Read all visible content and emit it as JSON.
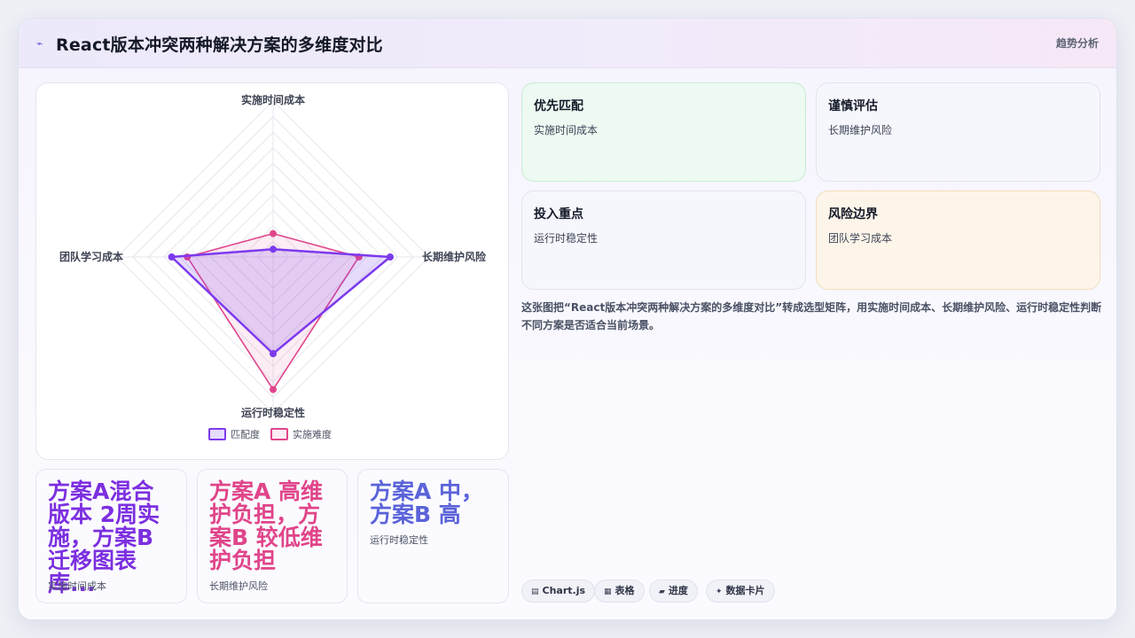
{
  "header": {
    "icon": "trend-icon",
    "title": "React版本冲突两种解决方案的多维度对比",
    "tag": "趋势分析"
  },
  "chart_data": {
    "type": "radar",
    "axes": [
      "实施时间成本",
      "长期维护风险",
      "运行时稳定性",
      "团队学习成本"
    ],
    "rlim": [
      0,
      100
    ],
    "grid": true,
    "legend_position": "bottom",
    "series": [
      {
        "name": "匹配度",
        "values": [
          5,
          75,
          62,
          65
        ],
        "color": "#7c3aed"
      },
      {
        "name": "实施难度",
        "values": [
          15,
          55,
          85,
          55
        ],
        "color": "#e0468c"
      }
    ]
  },
  "stats": [
    {
      "value": "方案A混合版本 2周实施，方案B迁移图表库...",
      "label": "实施时间成本",
      "color": "#7c2fe0"
    },
    {
      "value": "方案A 高维护负担，方案B 较低维护负担",
      "label": "长期维护风险",
      "color": "#e0458a"
    },
    {
      "value": "方案A 中，方案B 高",
      "label": "运行时稳定性",
      "color": "#5b63d9"
    }
  ],
  "insights": [
    {
      "title": "优先匹配",
      "detail": "实施时间成本",
      "bg": "#ecfaf2",
      "border": "#c7ecd7"
    },
    {
      "title": "谨慎评估",
      "detail": "长期维护风险",
      "bg": "#f6f7fc",
      "border": "#e1e4ef"
    },
    {
      "title": "投入重点",
      "detail": "运行时稳定性",
      "bg": "#f6f7fc",
      "border": "#e1e4ef"
    },
    {
      "title": "风险边界",
      "detail": "团队学习成本",
      "bg": "#fdf5e9",
      "border": "#f2dcbd"
    }
  ],
  "summary": "这张图把“React版本冲突两种解决方案的多维度对比”转成选型矩阵，用实施时间成本、长期维护风险、运行时稳定性判断不同方案是否适合当前场景。",
  "chips": [
    {
      "icon": "chart-icon",
      "glyph": "▤",
      "label": "Chart.js"
    },
    {
      "icon": "table-icon",
      "glyph": "▦",
      "label": "表格"
    },
    {
      "icon": "progress-icon",
      "glyph": "▰",
      "label": "进度"
    },
    {
      "icon": "sparkle-icon",
      "glyph": "✦",
      "label": "数据卡片"
    }
  ]
}
